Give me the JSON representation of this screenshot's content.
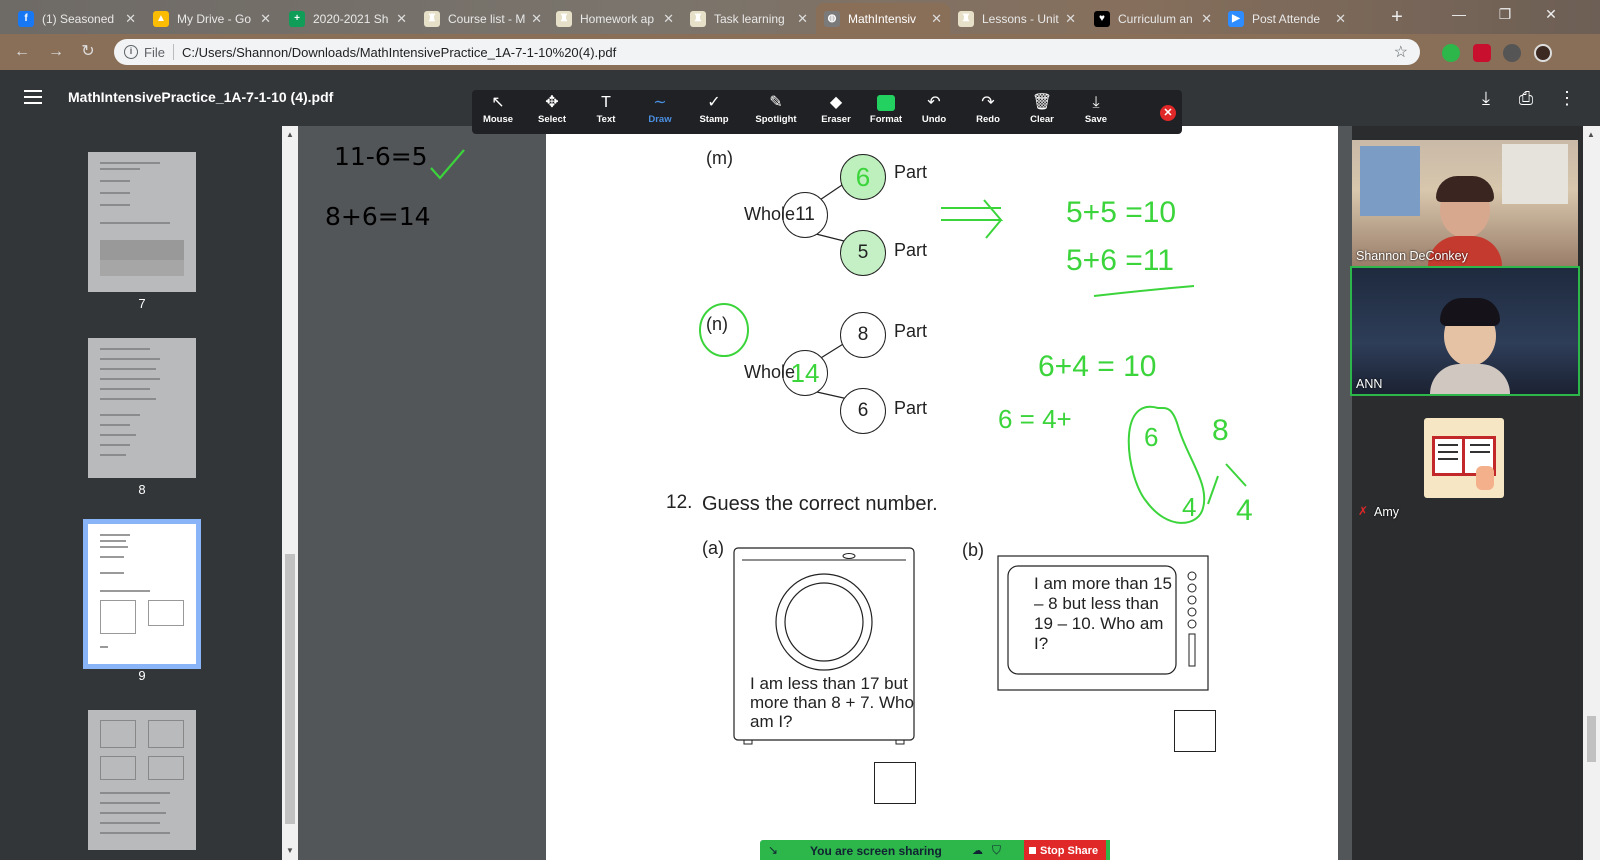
{
  "browser": {
    "tabs": [
      {
        "title": "(1) Seasoned",
        "fav_color": "#1877f2",
        "fav_glyph": "f"
      },
      {
        "title": "My Drive - Go",
        "fav_color": "#fbbc04",
        "fav_glyph": "▲"
      },
      {
        "title": "2020-2021 Sh",
        "fav_color": "#0f9d58",
        "fav_glyph": "+"
      },
      {
        "title": "Course list - M",
        "fav_color": "#e6e0c8",
        "fav_glyph": "♜"
      },
      {
        "title": "Homework ap",
        "fav_color": "#e6e0c8",
        "fav_glyph": "♜"
      },
      {
        "title": "Task learning",
        "fav_color": "#e6e0c8",
        "fav_glyph": "♜"
      },
      {
        "title": "MathIntensiv",
        "fav_color": "#7a7a7a",
        "fav_glyph": "◍"
      },
      {
        "title": "Lessons - Unit",
        "fav_color": "#e6e0c8",
        "fav_glyph": "♜"
      },
      {
        "title": "Curriculum an",
        "fav_color": "#000000",
        "fav_glyph": "♥"
      },
      {
        "title": "Post Attende",
        "fav_color": "#2d8cff",
        "fav_glyph": "▶"
      }
    ],
    "active_tab": 6,
    "newtab_label": "+",
    "window_controls": {
      "minimize": "—",
      "restore": "❐",
      "close": "✕"
    },
    "address": {
      "scheme_label": "File",
      "url": "C:/Users/Shannon/Downloads/MathIntensivePractice_1A-7-1-10%20(4).pdf"
    }
  },
  "pdf": {
    "title": "MathIntensivePractice_1A-7-1-10 (4).pdf",
    "thumbnails": [
      {
        "num": "7"
      },
      {
        "num": "8"
      },
      {
        "num": "9"
      }
    ]
  },
  "annotate": {
    "tools": [
      {
        "label": "Mouse",
        "glyph": "↖"
      },
      {
        "label": "Select",
        "glyph": "✥"
      },
      {
        "label": "Text",
        "glyph": "T"
      },
      {
        "label": "Draw",
        "glyph": "∼"
      },
      {
        "label": "Stamp",
        "glyph": "✓"
      },
      {
        "label": "Spotlight",
        "glyph": "✎"
      },
      {
        "label": "Eraser",
        "glyph": "◆"
      },
      {
        "label": "Format",
        "glyph": ""
      },
      {
        "label": "Undo",
        "glyph": "↶"
      },
      {
        "label": "Redo",
        "glyph": "↷"
      },
      {
        "label": "Clear",
        "glyph": "🗑"
      },
      {
        "label": "Save",
        "glyph": "⤓"
      }
    ],
    "selected": "Draw",
    "close_glyph": "✕",
    "format_color": "#23d160"
  },
  "scratch": {
    "line1": "11-6=5",
    "line2": "8+6=14"
  },
  "worksheet": {
    "m": {
      "label": "(m)",
      "whole_label": "Whole",
      "whole": "11",
      "part_label": "Part",
      "part1": "6",
      "part2": "5"
    },
    "n": {
      "label": "(n)",
      "whole_label": "Whole",
      "whole": "14",
      "part_label": "Part",
      "part1": "8",
      "part2": "6"
    },
    "q12": {
      "num": "12.",
      "text": "Guess the correct number."
    },
    "a": {
      "label": "(a)",
      "text": "I am less than 17 but more than 8 + 7. Who am I?"
    },
    "b": {
      "label": "(b)",
      "text": "I am more than 15 – 8 but less than 19 – 10. Who am I?"
    }
  },
  "ink": {
    "eq1": "5+5 =10",
    "eq2": "5+6 =11",
    "eq3": "6+4 = 10",
    "eq4": "6 = 4+",
    "t6": "6",
    "t8": "8",
    "t4a": "4",
    "t4b": "4"
  },
  "participants": [
    {
      "name": "Shannon DeConkey"
    },
    {
      "name": "ANN"
    },
    {
      "name": "Amy",
      "muted": true
    }
  ],
  "share": {
    "status": "You are screen sharing",
    "stop_label": "Stop Share"
  }
}
